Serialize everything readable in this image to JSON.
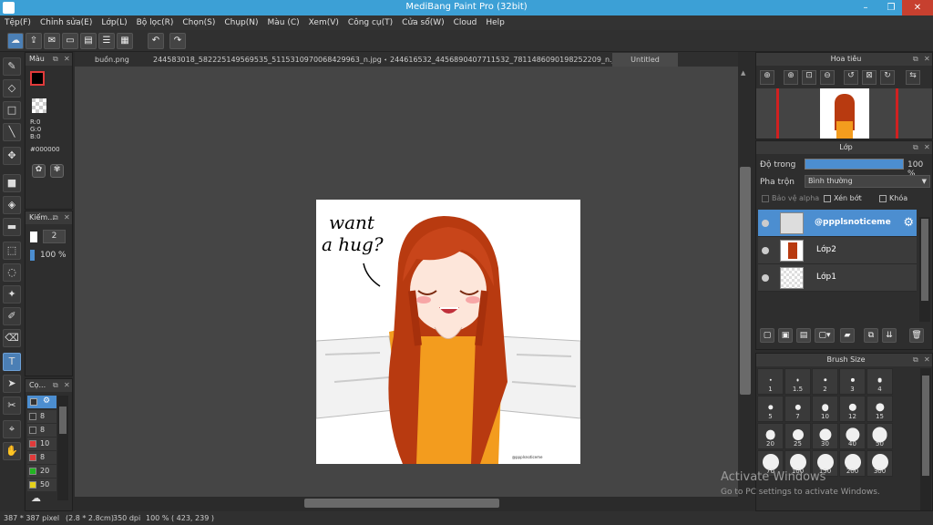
{
  "window": {
    "title": "MediBang Paint Pro (32bit)"
  },
  "menu": [
    "Tệp(F)",
    "Chỉnh sửa(E)",
    "Lớp(L)",
    "Bộ lọc(R)",
    "Chọn(S)",
    "Chụp(N)",
    "Màu (C)",
    "Xem(V)",
    "Công cụ(T)",
    "Cửa sổ(W)",
    "Cloud",
    "Help"
  ],
  "tabs": [
    "buồn.png",
    "244583018_582225149569535_5115310970068429963_n.jpg < c2 >",
    "244616532_4456890407711532_7811486090198252209_n.jpg",
    "Untitled"
  ],
  "color_panel": {
    "title": "Màu",
    "r": "R:0",
    "g": "G:0",
    "b": "B:0",
    "hex": "#000000"
  },
  "brush_panel": {
    "title": "Kiếm...",
    "size": "2",
    "opacity": "100 %"
  },
  "palette_panel": {
    "title": "Cọ...",
    "items": [
      {
        "value": "8",
        "color": "#333333"
      },
      {
        "value": "8",
        "color": "#333333"
      },
      {
        "value": "10",
        "color": "#e03a3a"
      },
      {
        "value": "8",
        "color": "#e03a3a"
      },
      {
        "value": "20",
        "color": "#22b422"
      },
      {
        "value": "50",
        "color": "#e6d21a"
      }
    ]
  },
  "navigator": {
    "title": "Hoa tiêu"
  },
  "layers_panel": {
    "title": "Lớp",
    "opacity_label": "Độ trong",
    "opacity_value": "100 %",
    "blend_label": "Pha trộn",
    "blend_value": "Bình thường",
    "protect_alpha": "Bảo vệ alpha",
    "clipping": "Xén bớt",
    "lock": "Khóa",
    "layers": [
      {
        "name": "@ppplsnoticeme",
        "selected": true
      },
      {
        "name": "Lớp2",
        "selected": false
      },
      {
        "name": "Lớp1",
        "selected": false
      }
    ]
  },
  "brush_size": {
    "title": "Brush Size",
    "sizes": [
      "1",
      "1.5",
      "2",
      "3",
      "4",
      "5",
      "7",
      "10",
      "12",
      "15",
      "20",
      "25",
      "30",
      "40",
      "50",
      "70",
      "100",
      "150",
      "200",
      "300"
    ]
  },
  "canvas": {
    "speech": [
      "want",
      "a hug?"
    ],
    "watermark": "@ppplsnoticeme"
  },
  "status": {
    "size": "387 * 387 pixel",
    "cm": "(2.8 * 2.8cm)",
    "dpi": "350 dpi",
    "zoom": "100 %",
    "coords": "( 423, 239 )"
  },
  "watermark": {
    "line1": "Activate Windows",
    "line2": "Go to PC settings to activate Windows."
  }
}
